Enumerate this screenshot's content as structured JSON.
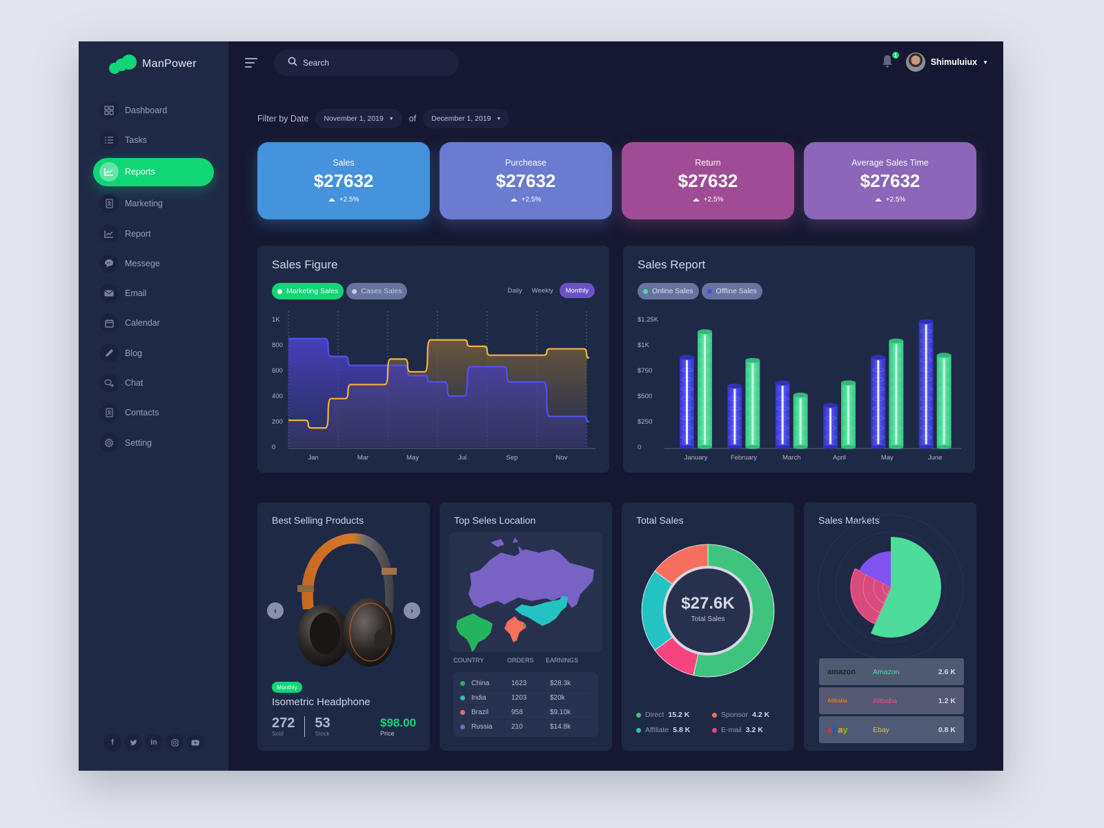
{
  "app": {
    "name": "ManPower"
  },
  "search": {
    "placeholder": "Search"
  },
  "user": {
    "name": "Shimuluiux",
    "notifications": "1"
  },
  "sidebar": {
    "items": [
      {
        "label": "Dashboard",
        "icon": "grid-icon"
      },
      {
        "label": "Tasks",
        "icon": "checklist-icon"
      },
      {
        "label": "Reports",
        "icon": "chart-icon",
        "active": true
      },
      {
        "label": "Marketing",
        "icon": "contact-book-icon"
      },
      {
        "label": "Report",
        "icon": "chart-icon"
      },
      {
        "label": "Messege",
        "icon": "speech-bubble-icon"
      },
      {
        "label": "Email",
        "icon": "envelope-icon"
      },
      {
        "label": "Calendar",
        "icon": "calendar-icon"
      },
      {
        "label": "Blog",
        "icon": "pencil-icon"
      },
      {
        "label": "Chat",
        "icon": "chat-bubbles-icon"
      },
      {
        "label": "Contacts",
        "icon": "contact-book-icon"
      },
      {
        "label": "Setting",
        "icon": "gear-icon"
      }
    ],
    "socials": [
      "f",
      "t",
      "in",
      "ig",
      "yt"
    ]
  },
  "filter": {
    "label": "Filter by Date",
    "from": "November 1, 2019",
    "sep": "of",
    "to": "December 1, 2019"
  },
  "kpis": [
    {
      "title": "Sales",
      "value": "$27632",
      "delta": "+2.5%",
      "color": "#4592dd"
    },
    {
      "title": "Purchease",
      "value": "$27632",
      "delta": "+2.5%",
      "color": "#6b7bcf"
    },
    {
      "title": "Return",
      "value": "$27632",
      "delta": "+2.5%",
      "color": "#a04c95"
    },
    {
      "title": "Average Sales Time",
      "value": "$27632",
      "delta": "+2.5%",
      "color": "#8b66b9"
    }
  ],
  "sales_figure": {
    "title": "Sales Figure",
    "legend": [
      {
        "label": "Marketing Sales",
        "color": "#11d676"
      },
      {
        "label": "Cases Sales",
        "color": "#6874a0"
      }
    ],
    "tabs": [
      "Daily",
      "Weekly",
      "Monthly"
    ],
    "active_tab": "Monthly"
  },
  "sales_report": {
    "title": "Sales Report",
    "legend": [
      {
        "label": "Online Sales",
        "color": "#4ddc9c"
      },
      {
        "label": "Offline Sales",
        "color": "#4a4af0"
      }
    ]
  },
  "best_selling": {
    "title": "Best Selling Products",
    "badge": "Monthly",
    "product": "Isometric Headphone",
    "sold": "272",
    "sold_label": "Sold",
    "stock": "53",
    "stock_label": "Stock",
    "price": "$98.00",
    "price_label": "Price"
  },
  "top_location": {
    "title": "Top Seles Location",
    "columns": [
      "COUNTRY",
      "ORDERS",
      "EARNINGS"
    ],
    "rows": [
      {
        "country": "China",
        "orders": "1623",
        "earnings": "$28.3k",
        "color": "#26b35e"
      },
      {
        "country": "India",
        "orders": "1203",
        "earnings": "$20k",
        "color": "#24c3c3"
      },
      {
        "country": "Brazil",
        "orders": "958",
        "earnings": "$9.10k",
        "color": "#f86f5e"
      },
      {
        "country": "Russia",
        "orders": "210",
        "earnings": "$14.8k",
        "color": "#7a64c4"
      }
    ]
  },
  "total_sales": {
    "title": "Total Sales",
    "center_value": "$27.6K",
    "center_label": "Total Sales",
    "legend": [
      {
        "label": "Direct",
        "value": "15.2 K",
        "color": "#3ec47f"
      },
      {
        "label": "Sponsor",
        "value": "4.2 K",
        "color": "#f56f5c"
      },
      {
        "label": "Affiliate",
        "value": "5.8 K",
        "color": "#25c2c4"
      },
      {
        "label": "E-mail",
        "value": "3.2 K",
        "color": "#f54480"
      }
    ]
  },
  "sales_markets": {
    "title": "Sales Markets",
    "rows": [
      {
        "logo": "amazon",
        "name": "Amazon",
        "value": "2.6 K",
        "color": "#4ddc9c",
        "bg": "#4d5a72"
      },
      {
        "logo": "Alibaba",
        "name": "Alibaba",
        "value": "1.2 K",
        "color": "#ee4f86",
        "bg": "#545873"
      },
      {
        "logo": "ebay",
        "name": "Ebay",
        "value": "0.8 K",
        "color": "#d5c84a",
        "bg": "#4f5a74"
      }
    ]
  },
  "chart_data": [
    {
      "type": "area",
      "title": "Sales Figure",
      "xlabel": "",
      "ylabel": "",
      "x_ticks": [
        "Jan",
        "Mar",
        "May",
        "Jul",
        "Sep",
        "Nov"
      ],
      "y_ticks": [
        "0",
        "200",
        "400",
        "600",
        "800",
        "1K"
      ],
      "ylim": [
        0,
        1000
      ],
      "step": true,
      "series": [
        {
          "name": "Marketing Sales",
          "color": "#5252f0",
          "values": [
            850,
            850,
            710,
            640,
            640,
            640,
            560,
            510,
            400,
            630,
            630,
            510,
            510,
            240,
            240,
            200
          ]
        },
        {
          "name": "Cases Sales",
          "color": "#f3b33b",
          "values": [
            210,
            150,
            380,
            490,
            490,
            690,
            590,
            840,
            840,
            790,
            720,
            720,
            720,
            770,
            770,
            700
          ]
        }
      ]
    },
    {
      "type": "bar",
      "title": "Sales Report",
      "categories": [
        "January",
        "February",
        "March",
        "April",
        "May",
        "June"
      ],
      "y_ticks": [
        "0",
        "$250",
        "$500",
        "$750",
        "$1K",
        "$1.25K"
      ],
      "ylim": [
        0,
        1250
      ],
      "series": [
        {
          "name": "Offline Sales",
          "color": "#4a4af0",
          "values": [
            880,
            600,
            630,
            410,
            880,
            1230
          ]
        },
        {
          "name": "Online Sales",
          "color": "#4ddc9c",
          "values": [
            1130,
            850,
            510,
            630,
            1040,
            900
          ]
        }
      ]
    },
    {
      "type": "pie",
      "title": "Total Sales",
      "labels": [
        "Direct",
        "E-mail",
        "Affiliate",
        "Sponsor"
      ],
      "values": [
        15.2,
        3.2,
        5.8,
        4.2
      ],
      "colors": [
        "#3ec47f",
        "#f54480",
        "#25c2c4",
        "#f56f5c"
      ]
    },
    {
      "type": "pie",
      "title": "Sales Markets",
      "labels": [
        "Amazon",
        "Alibaba",
        "Ebay"
      ],
      "values": [
        2.6,
        1.2,
        0.8
      ],
      "colors": [
        "#4ddc9c",
        "#d94b7c",
        "#8052f0"
      ]
    }
  ]
}
